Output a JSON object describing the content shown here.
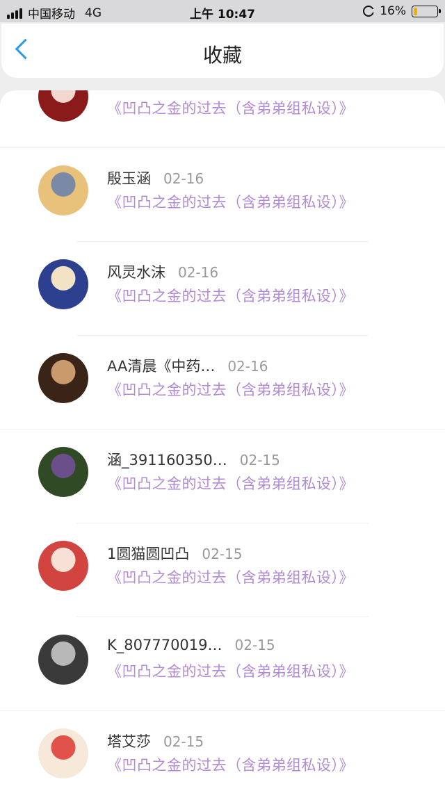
{
  "status": {
    "carrier": "中国移动",
    "network": "4G",
    "time": "上午 10:47",
    "battery": "16%",
    "battery_level": 0.16
  },
  "header": {
    "title": "收藏"
  },
  "items": [
    {
      "name": "",
      "date": "",
      "work": "《凹凸之金的过去（含弟弟组私设）》",
      "avatar": [
        "#8b1a1a",
        "#f2d7d0"
      ]
    },
    {
      "name": "殷玉涵",
      "date": "02-16",
      "work": "《凹凸之金的过去（含弟弟组私设）》",
      "avatar": [
        "#e8c27a",
        "#7a8aa6"
      ]
    },
    {
      "name": "风灵水沫",
      "date": "02-16",
      "work": "《凹凸之金的过去（含弟弟组私设）》",
      "avatar": [
        "#2d3f8f",
        "#f1e3c4"
      ]
    },
    {
      "name": "AA清晨《中药…",
      "date": "02-16",
      "work": "《凹凸之金的过去（含弟弟组私设）》",
      "avatar": [
        "#3a2418",
        "#c99a6c"
      ]
    },
    {
      "name": "涵_391160350…",
      "date": "02-15",
      "work": "《凹凸之金的过去（含弟弟组私设）》",
      "avatar": [
        "#2f4a24",
        "#6b4f8a"
      ]
    },
    {
      "name": "1圆猫圆凹凸",
      "date": "02-15",
      "work": "《凹凸之金的过去（含弟弟组私设）》",
      "avatar": [
        "#d2443f",
        "#f7e0d5"
      ]
    },
    {
      "name": "K_807770019…",
      "date": "02-15",
      "work": "《凹凸之金的过去（含弟弟组私设）》",
      "avatar": [
        "#3a3a3a",
        "#b8b8b8"
      ]
    },
    {
      "name": "塔艾莎",
      "date": "02-15",
      "work": "《凹凸之金的过去（含弟弟组私设）》",
      "avatar": [
        "#f6e9da",
        "#e0524a"
      ]
    }
  ]
}
